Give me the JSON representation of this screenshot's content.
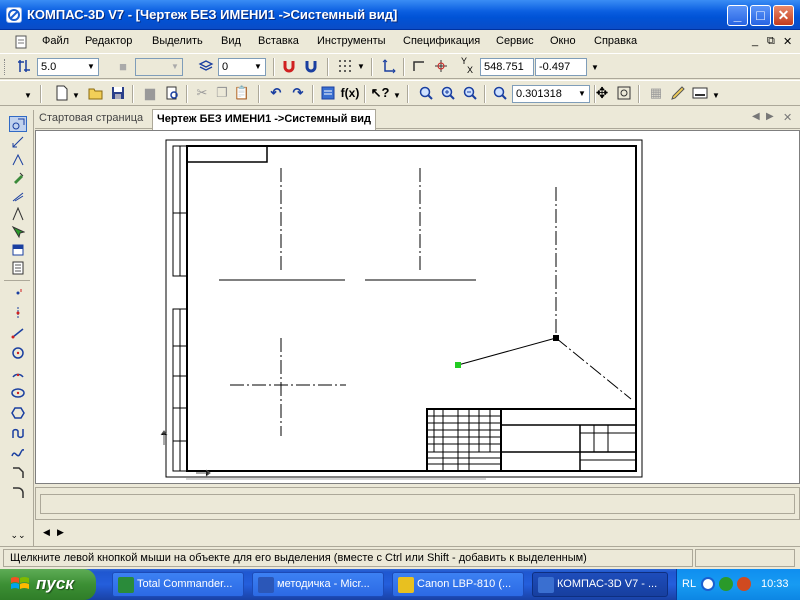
{
  "window": {
    "title": "КОМПАС-3D V7 - [Чертеж БЕЗ ИМЕНИ1 ->Системный вид]"
  },
  "menu": {
    "items": [
      "Файл",
      "Редактор",
      "Выделить",
      "Вид",
      "Вставка",
      "Инструменты",
      "Спецификация",
      "Сервис",
      "Окно",
      "Справка"
    ]
  },
  "toolbar_params": {
    "line_width": "5.0",
    "layer": "0",
    "coord_x": "548.751",
    "coord_y": "-0.497",
    "x_label": "X",
    "y_label": "Y"
  },
  "toolbar_standard": {
    "zoom_value": "0.301318"
  },
  "tabs": [
    {
      "label": "Стартовая страница",
      "active": false
    },
    {
      "label": "Чертеж БЕЗ ИМЕНИ1 ->Системный вид",
      "active": true
    }
  ],
  "status": {
    "hint": "Щелкните левой кнопкой мыши на объекте для его выделения (вместе с Ctrl или Shift - добавить к выделенным)"
  },
  "taskbar": {
    "start_label": "пуск",
    "buttons": [
      {
        "label": "Total Commander...",
        "active": false,
        "color": "#2a8b3a"
      },
      {
        "label": "методичка - Micr...",
        "active": false,
        "color": "#2b57b8"
      },
      {
        "label": "Canon LBP-810 (...",
        "active": false,
        "color": "#e8c020"
      },
      {
        "label": "КОМПАС-3D V7 - ...",
        "active": true,
        "color": "#3a6fd0"
      }
    ],
    "language": "RL",
    "clock": "10:33"
  },
  "colors": {
    "selection_point": "#22cc22",
    "title_bar": "#0a5ee0"
  },
  "icons": {
    "app": "kompas-icon",
    "minimize": "minimize-icon",
    "maximize": "maximize-icon",
    "close": "close-icon"
  }
}
